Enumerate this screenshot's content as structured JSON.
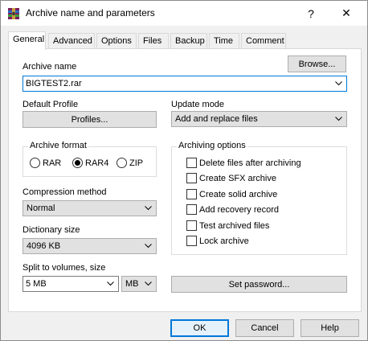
{
  "window": {
    "title": "Archive name and parameters",
    "help_glyph": "?",
    "close_glyph": "✕"
  },
  "tabs": [
    {
      "label": "General",
      "active": true
    },
    {
      "label": "Advanced"
    },
    {
      "label": "Options"
    },
    {
      "label": "Files"
    },
    {
      "label": "Backup"
    },
    {
      "label": "Time"
    },
    {
      "label": "Comment"
    }
  ],
  "archive": {
    "label": "Archive name",
    "browse_label": "Browse...",
    "name_value": "BIGTEST2.rar"
  },
  "profile": {
    "label": "Default Profile",
    "button_label": "Profiles..."
  },
  "update_mode": {
    "label": "Update mode",
    "value": "Add and replace files"
  },
  "archive_format": {
    "label": "Archive format",
    "options": [
      "RAR",
      "RAR4",
      "ZIP"
    ],
    "selected": "RAR4"
  },
  "compression": {
    "label": "Compression method",
    "value": "Normal"
  },
  "dictionary": {
    "label": "Dictionary size",
    "value": "4096 KB"
  },
  "split": {
    "label": "Split to volumes, size",
    "value": "5 MB",
    "unit": "MB"
  },
  "archiving_options": {
    "label": "Archiving options",
    "items": [
      {
        "label": "Delete files after archiving",
        "checked": false
      },
      {
        "label": "Create SFX archive",
        "checked": false
      },
      {
        "label": "Create solid archive",
        "checked": false
      },
      {
        "label": "Add recovery record",
        "checked": false
      },
      {
        "label": "Test archived files",
        "checked": false
      },
      {
        "label": "Lock archive",
        "checked": false
      }
    ]
  },
  "set_password_label": "Set password...",
  "footer": {
    "ok_label": "OK",
    "cancel_label": "Cancel",
    "help_label": "Help"
  },
  "colors": {
    "accent": "#0078d7",
    "button_face": "#e1e1e1",
    "dialog_bg": "#f0f0f0"
  }
}
